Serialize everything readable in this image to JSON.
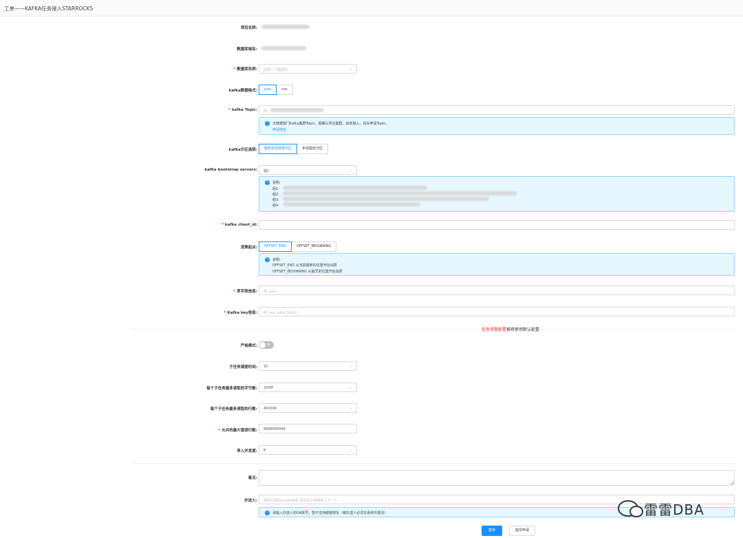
{
  "window": {
    "title": "工单——KAFKA任务接入STARROCKS"
  },
  "form": {
    "project_name_label": "项目名称:",
    "db_domain_label": "数据库域名:",
    "db_name_label": "数据库名称:",
    "db_name_placeholder": "选择一个数据库",
    "kafka_format_label": "kafka数据格式:",
    "kafka_format_options": [
      "json",
      "csv"
    ],
    "kafka_topic_label": "kafka Topic:",
    "kafka_topic_placeholder": "例:",
    "topic_alert_text": "大数据部门Kafka集群Topic，需确认所在集群，如未接入，请先申请Topic。",
    "topic_alert_link": "申请地址",
    "partition_label": "kafka分区选择:",
    "partition_options": [
      "程序自动选择分区",
      "手动指定分区"
    ],
    "bootstrap_label": "kafka bootstrap servers:",
    "bootstrap_value": "组1",
    "bootstrap_alert_title": "说明:",
    "bootstrap_alert_lines": [
      "组1:",
      "组2:",
      "组3:",
      "组4:"
    ],
    "client_id_label": "kafka client_id:",
    "offset_label": "消费起点:",
    "offset_options": [
      "OFFSET_END",
      "OFFSET_BEGINNING"
    ],
    "offset_alert_title": "说明:",
    "offset_alert_line1": "OFFSET_END 从当前最新的位置开始消费",
    "offset_alert_line2": "OFFSET_BEGINNING 从最早的位置开始消费",
    "table_label": "表字段信息:",
    "table_placeholder": "例: pdur",
    "kafka_key_label": "Kafka key信息:",
    "kafka_key_placeholder": "例: key_sdeq_0deg_t",
    "section_text_red": "任务参数配置",
    "section_text_rest": "推荐使用默认配置",
    "strict_label": "严格模式:",
    "strict_state": "关",
    "subtask_interval_label": "子任务调度时间:",
    "subtask_interval_value": "10",
    "max_bytes_label": "每个子任务最多读取的字节数:",
    "max_bytes_value": "100M",
    "max_rows_label": "每个子任务最多读取的行数:",
    "max_rows_value": "400000",
    "max_error_label": "允许的最大错误行数:",
    "max_error_value": "9999999999",
    "concurrency_label": "导入并发度:",
    "concurrency_value": "8",
    "remark_label": "备注:",
    "cc_label": "抄送人:",
    "cc_placeholder": "请对抄送的leader和组 地址在公司等输入下一个",
    "cc_alert_text": "请输入抄送人的OA账号，暂不支持邮箱地址（被抄送人必须在系统中激活）",
    "save_button": "暂存",
    "submit_button": "提交申请"
  },
  "watermark": {
    "text": "雷雷DBA"
  },
  "colors": {
    "primary": "#1890ff",
    "required": "#f5222d",
    "alert_bg": "#e6f7ff"
  },
  "icons": [
    "info-icon",
    "chevron-down-icon",
    "wechat-logo-icon"
  ]
}
